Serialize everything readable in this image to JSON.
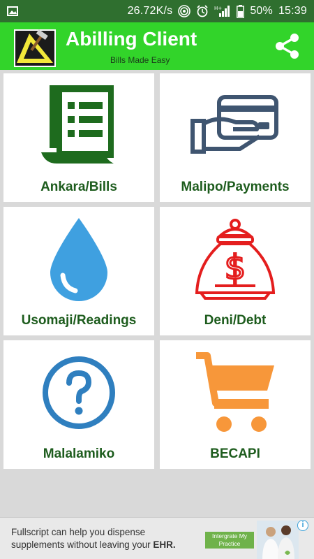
{
  "status_bar": {
    "speed": "26.72K/s",
    "battery": "50%",
    "time": "15:39"
  },
  "app_bar": {
    "title": "Abilling Client",
    "subtitle": "Bills Made Easy"
  },
  "tiles": [
    {
      "label": "Ankara/Bills",
      "icon": "bills-icon",
      "color": "#1e6b1e"
    },
    {
      "label": "Malipo/Payments",
      "icon": "payment-card-hand-icon",
      "color": "#3f5570"
    },
    {
      "label": "Usomaji/Readings",
      "icon": "water-drop-icon",
      "color": "#3fa0e0"
    },
    {
      "label": "Deni/Debt",
      "icon": "money-bag-icon",
      "color": "#e41e1e"
    },
    {
      "label": "Malalamiko",
      "icon": "help-question-icon",
      "color": "#2f7fbf"
    },
    {
      "label": "BECAPI",
      "icon": "shopping-cart-icon",
      "color": "#f7973a"
    }
  ],
  "ad": {
    "text_line1": "Fullscript can help you dispense",
    "text_line2_prefix": "supplements without leaving your ",
    "text_line2_bold": "EHR.",
    "button_label": "Intergrate My Practice"
  },
  "colors": {
    "status_bar": "#2f6f2f",
    "app_bar": "#32d42a",
    "label_text": "#1d5c1d",
    "background": "#d9d9d9"
  }
}
